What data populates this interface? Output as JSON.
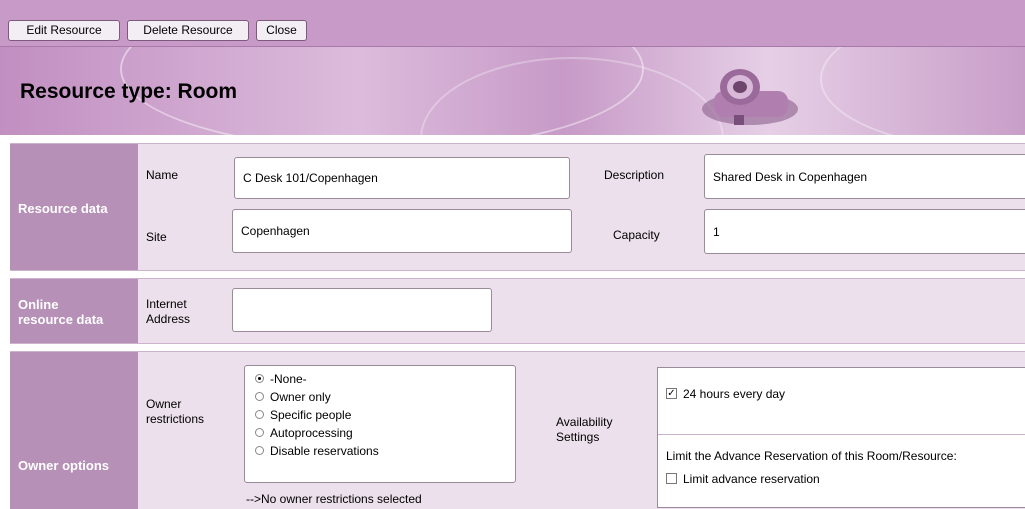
{
  "toolbar": {
    "edit_label": "Edit Resource",
    "delete_label": "Delete Resource",
    "close_label": "Close"
  },
  "banner": {
    "title": "Resource type: Room"
  },
  "resource_data": {
    "section_label": "Resource data",
    "name_label": "Name",
    "name_value": "C Desk 101/Copenhagen",
    "description_label": "Description",
    "description_value": "Shared Desk in Copenhagen",
    "site_label": "Site",
    "site_value": "Copenhagen",
    "capacity_label": "Capacity",
    "capacity_value": "1"
  },
  "online_data": {
    "section_label_line1": "Online",
    "section_label_line2": "resource data",
    "internet_label_line1": "Internet",
    "internet_label_line2": "Address",
    "internet_value": ""
  },
  "owner_options": {
    "section_label": "Owner options",
    "restrictions_label_line1": "Owner",
    "restrictions_label_line2": "restrictions",
    "options": [
      "-None-",
      "Owner only",
      "Specific people",
      "Autoprocessing",
      "Disable reservations"
    ],
    "selected_option": "-None-",
    "status_text": "-->No owner restrictions selected",
    "availability_label_line1": "Availability",
    "availability_label_line2": "Settings",
    "hours_label": "24 hours every day",
    "hours_checked": true,
    "limit_title": "Limit the Advance Reservation of this Room/Resource:",
    "limit_label": "Limit advance reservation",
    "limit_checked": false
  },
  "colors": {
    "toolbar": "#c79ac7",
    "section_label_bg": "#b690b6",
    "section_bg": "#ebe0eb"
  }
}
